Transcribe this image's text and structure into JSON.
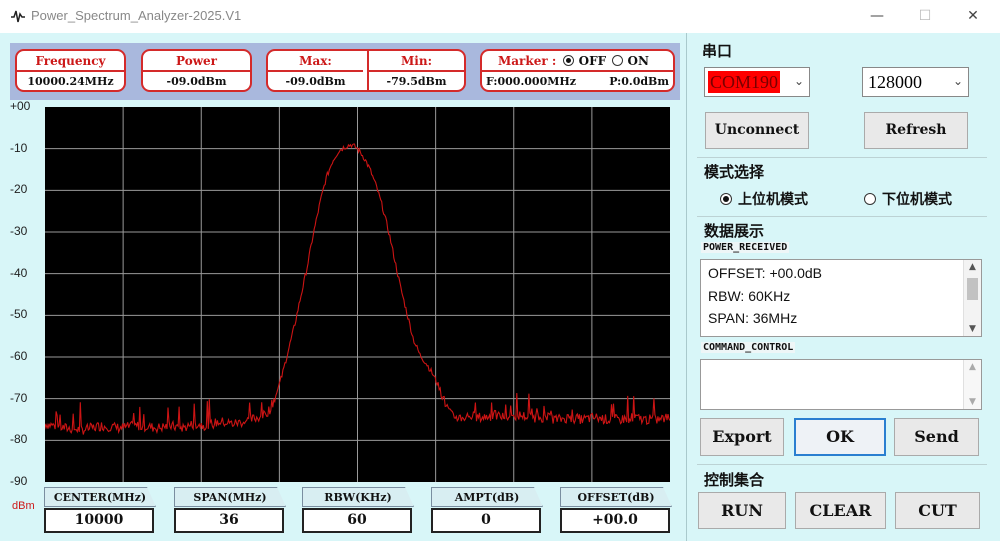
{
  "window": {
    "title": "Power_Spectrum_Analyzer-2025.V1",
    "minimize": "—",
    "maximize": "☐",
    "close": "✕"
  },
  "info": {
    "frequency": {
      "label": "Frequency",
      "value": "10000.24MHz"
    },
    "power": {
      "label": "Power",
      "value": "-09.0dBm"
    },
    "max": {
      "label": "Max:",
      "value": "-09.0dBm"
    },
    "min": {
      "label": "Min:",
      "value": "-79.5dBm"
    },
    "marker": {
      "label": "Marker :",
      "off_label": "OFF",
      "on_label": "ON",
      "selected": "OFF",
      "freq": "F:000.000MHz",
      "power": "P:0.0dBm"
    }
  },
  "plot": {
    "unit": "dBm",
    "y_ticks": [
      "+00",
      "-10",
      "-20",
      "-30",
      "-40",
      "-50",
      "-60",
      "-70",
      "-80",
      "-90"
    ]
  },
  "params": [
    {
      "label": "CENTER(MHz)",
      "value": "10000"
    },
    {
      "label": "SPAN(MHz)",
      "value": "36"
    },
    {
      "label": "RBW(KHz)",
      "value": "60"
    },
    {
      "label": "AMPT(dB)",
      "value": "0"
    },
    {
      "label": "OFFSET(dB)",
      "value": "+00.0"
    }
  ],
  "serial": {
    "title": "串口",
    "port": "COM190",
    "baud": "128000",
    "unconnect": "Unconnect",
    "refresh": "Refresh"
  },
  "mode": {
    "title": "模式选择",
    "upper": "上位机模式",
    "lower": "下位机模式",
    "selected": "upper"
  },
  "data_display": {
    "title": "数据展示",
    "received_label": "POWER_RECEIVED",
    "received_lines": [
      "OFFSET: +00.0dB",
      "RBW: 60KHz",
      "SPAN: 36MHz"
    ],
    "command_label": "COMMAND_CONTROL",
    "export": "Export",
    "ok": "OK",
    "send": "Send"
  },
  "control": {
    "title": "控制集合",
    "run": "RUN",
    "clear": "CLEAR",
    "cut": "CUT"
  },
  "colors": {
    "trace": "#cc1414",
    "grid": "#9a9a9a",
    "plot_bg": "#000000",
    "panel_bg": "#d8f6f8",
    "port_highlight": "#ff0000"
  },
  "chart_data": {
    "type": "line",
    "xlabel": "",
    "ylabel": "dBm",
    "ylim": [
      -90,
      0
    ],
    "grid": true,
    "x_ticks_labeled": false,
    "series": [
      {
        "x": [
          0,
          3,
          6,
          9,
          12,
          15,
          18,
          20,
          22,
          24,
          26,
          28,
          30,
          32,
          34,
          35,
          36,
          37,
          38,
          39,
          40,
          41,
          42,
          43,
          44,
          45,
          46,
          47,
          48,
          49,
          50,
          51,
          52,
          53,
          54,
          55,
          56,
          57,
          58,
          59,
          60,
          61,
          62,
          63,
          64,
          65,
          66,
          67,
          68,
          69,
          70,
          72,
          74,
          76,
          78,
          80,
          82,
          84,
          86,
          88,
          90,
          92,
          94,
          96,
          98,
          100
        ],
        "y": [
          -76,
          -77,
          -77.5,
          -76.5,
          -77,
          -76.5,
          -77,
          -76.5,
          -77,
          -76,
          -76.5,
          -75.5,
          -76,
          -75.5,
          -74.5,
          -74,
          -72.5,
          -69,
          -64,
          -58,
          -52,
          -45,
          -38,
          -30,
          -23,
          -17,
          -13,
          -10.5,
          -9.5,
          -9,
          -10,
          -12,
          -15,
          -19,
          -24,
          -30,
          -37,
          -44,
          -50,
          -56,
          -59.5,
          -61.5,
          -64,
          -67,
          -71,
          -74,
          -74.5,
          -74.5,
          -74,
          -74.5,
          -74.5,
          -74,
          -74.5,
          -74,
          -74.5,
          -74.5,
          -75,
          -74.5,
          -75,
          -74.5,
          -75,
          -75,
          -74.5,
          -75,
          -75,
          -74.5
        ]
      }
    ]
  }
}
